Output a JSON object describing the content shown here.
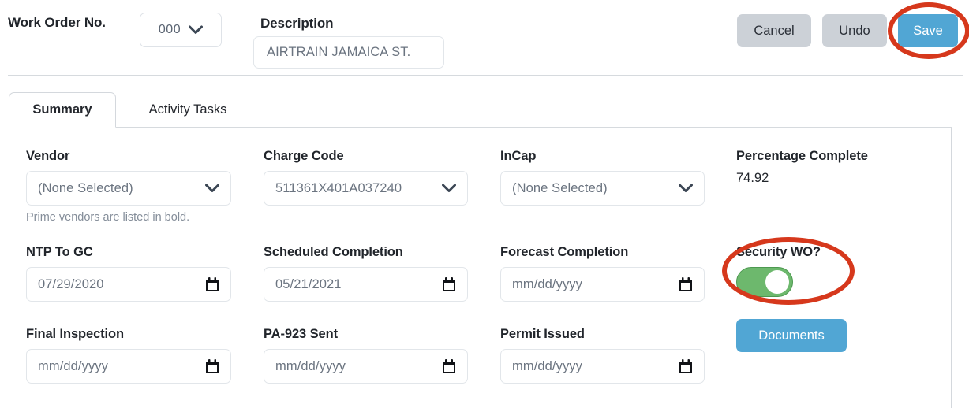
{
  "header": {
    "work_order_label": "Work Order No.",
    "work_order_value": "000",
    "description_label": "Description",
    "description_value": "AIRTRAIN JAMAICA ST.",
    "cancel_label": "Cancel",
    "undo_label": "Undo",
    "save_label": "Save"
  },
  "tabs": [
    {
      "label": "Summary",
      "active": true
    },
    {
      "label": "Activity Tasks",
      "active": false
    }
  ],
  "summary": {
    "vendor": {
      "label": "Vendor",
      "value": "(None Selected)",
      "helper": "Prime vendors are listed in bold."
    },
    "charge_code": {
      "label": "Charge Code",
      "value": "511361X401A037240"
    },
    "incap": {
      "label": "InCap",
      "value": "(None Selected)"
    },
    "percentage_complete": {
      "label": "Percentage Complete",
      "value": "74.92"
    },
    "ntp_to_gc": {
      "label": "NTP To GC",
      "value": "07/29/2020",
      "placeholder": "mm/dd/yyyy"
    },
    "scheduled_completion": {
      "label": "Scheduled Completion",
      "value": "05/21/2021",
      "placeholder": "mm/dd/yyyy"
    },
    "forecast_completion": {
      "label": "Forecast Completion",
      "value": "mm/dd/yyyy",
      "placeholder": "mm/dd/yyyy"
    },
    "security_wo": {
      "label": "Security WO?",
      "state": "on"
    },
    "final_inspection": {
      "label": "Final Inspection",
      "value": "mm/dd/yyyy",
      "placeholder": "mm/dd/yyyy"
    },
    "pa923_sent": {
      "label": "PA-923 Sent",
      "value": "mm/dd/yyyy",
      "placeholder": "mm/dd/yyyy"
    },
    "permit_issued": {
      "label": "Permit Issued",
      "value": "mm/dd/yyyy",
      "placeholder": "mm/dd/yyyy"
    },
    "documents_label": "Documents"
  },
  "colors": {
    "primary_blue": "#51a6d4",
    "button_grey": "#ccd1d7",
    "toggle_green": "#6db86d",
    "annotation_red": "#d6381c",
    "border_grey": "#e2e6ea",
    "text_dark": "#21252b",
    "text_muted": "#6b7480"
  },
  "annotations": [
    {
      "name": "save-button-highlight",
      "shape": "ellipse",
      "color": "#d6381c"
    },
    {
      "name": "security-wo-highlight",
      "shape": "ellipse",
      "color": "#d6381c"
    }
  ]
}
